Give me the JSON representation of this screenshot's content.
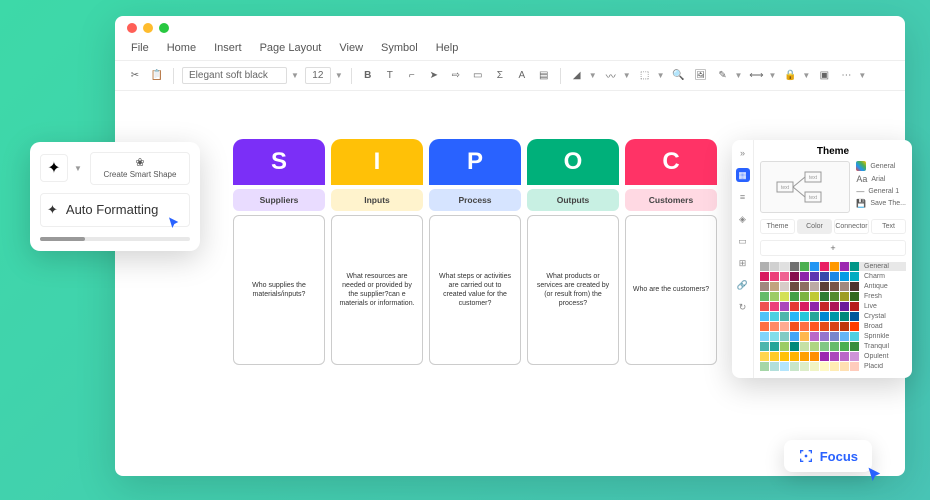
{
  "menus": [
    "File",
    "Home",
    "Insert",
    "Page Layout",
    "View",
    "Symbol",
    "Help"
  ],
  "toolbar": {
    "font": "Elegant soft black",
    "size": "12"
  },
  "sipoc": [
    {
      "letter": "S",
      "label": "Suppliers",
      "body": "Who supplies the materials/inputs?"
    },
    {
      "letter": "I",
      "label": "Inputs",
      "body": "What resources are needed or provided by the supplier?can e materials or information."
    },
    {
      "letter": "P",
      "label": "Process",
      "body": "What steps or activities are carried out to created value for the customer?"
    },
    {
      "letter": "O",
      "label": "Outputs",
      "body": "What products or services are created by (or result from) the process?"
    },
    {
      "letter": "C",
      "label": "Customers",
      "body": "Who are the customers?"
    }
  ],
  "floater": {
    "smart": "Create Smart Shape",
    "auto": "Auto Formatting"
  },
  "theme": {
    "title": "Theme",
    "styles": [
      {
        "label": "General"
      },
      {
        "label": "Arial"
      },
      {
        "label": "General 1"
      },
      {
        "label": "Save The..."
      }
    ],
    "tabs": [
      "Theme",
      "Color",
      "Connector",
      "Text"
    ],
    "swatches": [
      "General",
      "Charm",
      "Antique",
      "Fresh",
      "Live",
      "Crystal",
      "Broad",
      "Sprinkle",
      "Tranquil",
      "Opulent",
      "Placid"
    ],
    "palettes": [
      [
        "#b0b0b0",
        "#d0d0d0",
        "#e0e0e0",
        "#707070",
        "#4caf50",
        "#2196f3",
        "#e91e63",
        "#ff9800",
        "#9c27b0",
        "#009688"
      ],
      [
        "#d81b60",
        "#ec407a",
        "#f06292",
        "#880e4f",
        "#8e24aa",
        "#5e35b1",
        "#3949ab",
        "#1e88e5",
        "#039be5",
        "#00acc1"
      ],
      [
        "#a1887f",
        "#c2a47e",
        "#d7ccc8",
        "#6d4c41",
        "#8d6e63",
        "#bcaaa4",
        "#5d4037",
        "#795548",
        "#a1887f",
        "#4e342e"
      ],
      [
        "#66bb6a",
        "#9ccc65",
        "#d4e157",
        "#43a047",
        "#7cb342",
        "#c0ca33",
        "#2e7d32",
        "#558b2f",
        "#9e9d24",
        "#33691e"
      ],
      [
        "#ef5350",
        "#ec407a",
        "#ab47bc",
        "#e53935",
        "#d81b60",
        "#8e24aa",
        "#c62828",
        "#ad1457",
        "#6a1b9a",
        "#b71c1c"
      ],
      [
        "#4fc3f7",
        "#4dd0e1",
        "#4db6ac",
        "#29b6f6",
        "#26c6da",
        "#26a69a",
        "#0288d1",
        "#0097a7",
        "#00897b",
        "#01579b"
      ],
      [
        "#ff7043",
        "#ff8a65",
        "#ffab91",
        "#f4511e",
        "#ff7043",
        "#ff5722",
        "#e64a19",
        "#d84315",
        "#bf360c",
        "#ff3d00"
      ],
      [
        "#81d4fa",
        "#80deea",
        "#80cbc4",
        "#42a5f5",
        "#ffb74d",
        "#ba68c8",
        "#9575cd",
        "#7986cb",
        "#64b5f6",
        "#4dd0e1"
      ],
      [
        "#4db6ac",
        "#26a69a",
        "#9ccc65",
        "#00897b",
        "#c5e1a5",
        "#aed581",
        "#81c784",
        "#66bb6a",
        "#4caf50",
        "#388e3c"
      ],
      [
        "#ffd54f",
        "#ffca28",
        "#ffc107",
        "#ffb300",
        "#ffa000",
        "#ff8f00",
        "#9c27b0",
        "#ab47bc",
        "#ba68c8",
        "#ce93d8"
      ],
      [
        "#a5d6a7",
        "#b2dfdb",
        "#b3e5fc",
        "#c8e6c9",
        "#dcedc8",
        "#f0f4c3",
        "#fff9c4",
        "#ffecb3",
        "#ffe0b2",
        "#ffccbc"
      ]
    ]
  },
  "focus": "Focus"
}
